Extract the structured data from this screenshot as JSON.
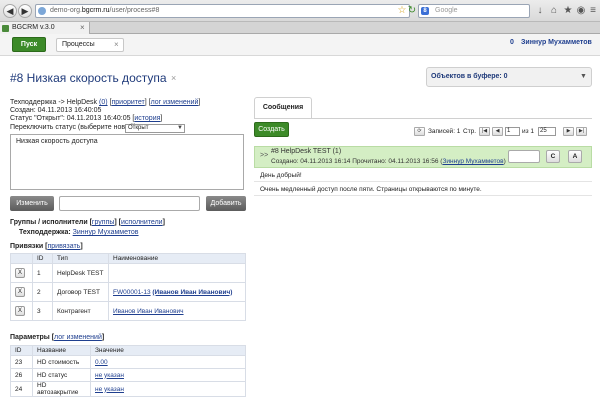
{
  "browser": {
    "url_prefix": "demo-org.",
    "url_host": "bgcrm.ru",
    "url_path": "/user/process#8",
    "search_placeholder": "Google",
    "search_logo": "8",
    "tab_title": "BGCRM v.3.0",
    "back_icon": "back-arrow-icon",
    "forward_icon": "forward-arrow-icon"
  },
  "header": {
    "start_label": "Пуск",
    "process_tab_label": "Процессы",
    "user_count": "0",
    "user_name": "Зиннур Мухамметов"
  },
  "process": {
    "title": "#8 Низкая скорость доступа",
    "path_text": "Техподдержка -> HelpDesk",
    "path_count": "(0)",
    "priority_link": "приоритет",
    "changelog_link": "лог изменений",
    "created": "Создан: 04.11.2013 16:40:05",
    "status_text": "Статус \"Открыт\": 04.11.2013 16:40:05",
    "history_link": "история",
    "switch_status_label": "Переключить статус (выберите новый):",
    "status_value": "Открыт",
    "description": "Низкая скорость доступа",
    "change_button": "Изменить",
    "add_button": "Добавить"
  },
  "executors": {
    "heading": "Группы / исполнители",
    "groups_link": "группы",
    "executors_link": "исполнители",
    "group_label": "Техподдержка:",
    "executor_name": "Зиннур Мухамметов"
  },
  "links": {
    "heading": "Привязки",
    "add_link": "привязать",
    "columns": [
      "",
      "ID",
      "Тип",
      "Наименование"
    ],
    "rows": [
      {
        "delete": "X",
        "id": "1",
        "type": "HelpDesk TEST",
        "name": "",
        "name_bold": ""
      },
      {
        "delete": "X",
        "id": "2",
        "type": "Договор TEST",
        "name": "FW00001-13",
        "name_bold": "(Иванов Иван Иванович)"
      },
      {
        "delete": "X",
        "id": "3",
        "type": "Контрагент",
        "name": "Иванов Иван Иванович",
        "name_bold": ""
      }
    ]
  },
  "params": {
    "heading": "Параметры",
    "changelog_link": "лог изменений",
    "columns": [
      "ID",
      "Название",
      "Значение"
    ],
    "rows": [
      {
        "id": "23",
        "name": "HD стоимость",
        "value": "0.00"
      },
      {
        "id": "26",
        "name": "HD статус",
        "value": "не указан"
      },
      {
        "id": "24",
        "name": "HD автозакрытие",
        "value": "не указан"
      }
    ]
  },
  "buffer": {
    "label": "Объектов в буфере: 0"
  },
  "messages": {
    "tab_label": "Сообщения",
    "create_button": "Создать",
    "records_label": "Записей: 1",
    "page_label": "Стр.",
    "page_value": "1",
    "of_label": "из 1",
    "page_size": "25",
    "item": {
      "expand": ">>",
      "title": "#8 HelpDesk TEST (1)",
      "meta": "Создано: 04.11.2013 16:14 Прочитано: 04.11.2013 16:56",
      "author": "Зиннур Мухамметов",
      "btn_c": "C",
      "btn_a": "A",
      "greeting": "День добрый!",
      "text": "Очень медленный доступ после пяти. Страницы открываются по минуте."
    }
  }
}
